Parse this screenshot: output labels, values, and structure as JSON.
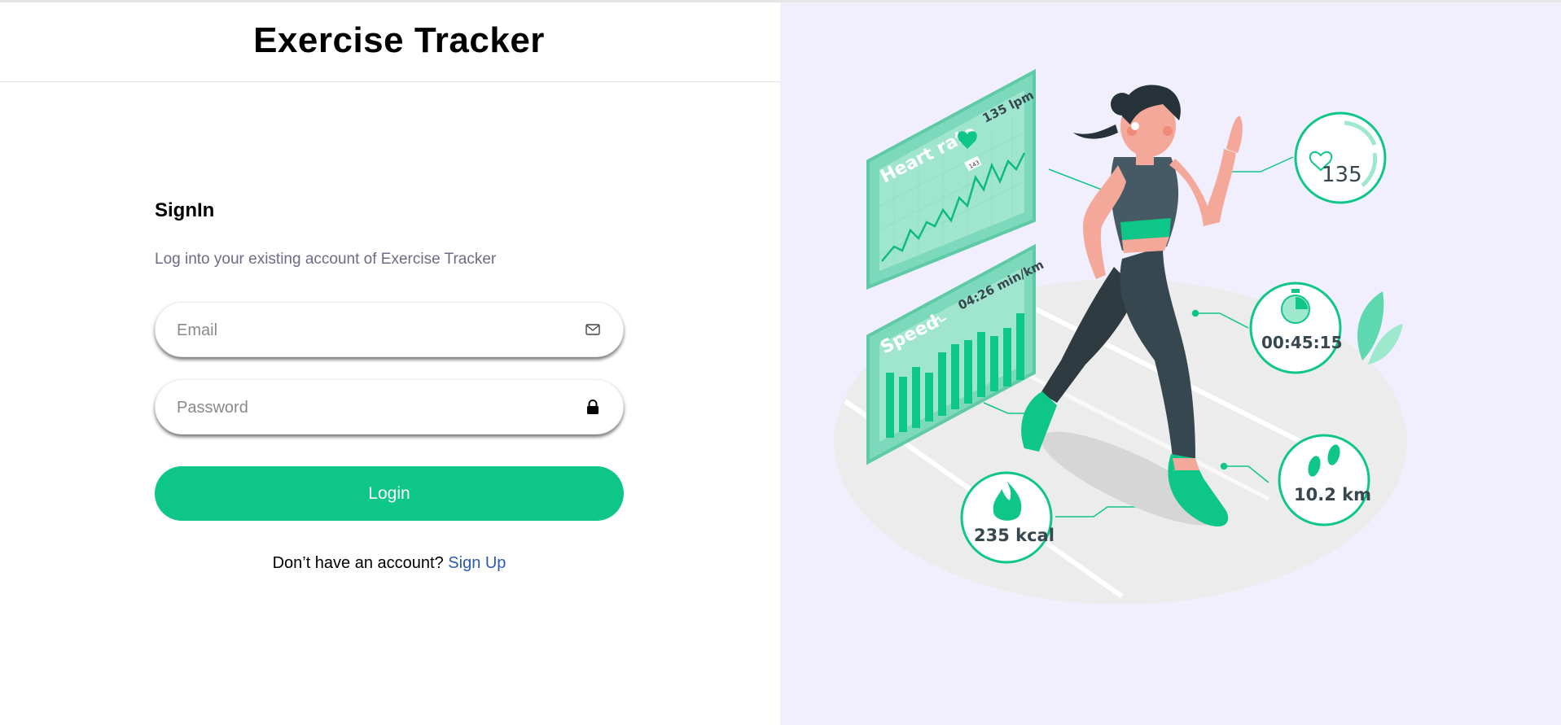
{
  "app": {
    "title": "Exercise Tracker"
  },
  "signin": {
    "title": "SignIn",
    "subtitle": "Log into your existing account of Exercise Tracker",
    "email": {
      "placeholder": "Email",
      "value": "",
      "icon": "mail-icon"
    },
    "password": {
      "placeholder": "Password",
      "value": "",
      "icon": "lock-icon"
    },
    "login_label": "Login",
    "signup_prompt": "Don’t have an account?",
    "signup_link": "Sign Up"
  },
  "illustration": {
    "heart_rate_label": "Heart rate",
    "heart_rate_value": "135 lpm",
    "graph_tag": "143",
    "speed_label": "Speed",
    "speed_value": "04:26 min/km",
    "bpm": "135",
    "time": "00:45:15",
    "calories": "235 kcal",
    "distance": "10.2 km"
  },
  "colors": {
    "accent": "#0fc689",
    "link": "#2d5aa8",
    "subtitle": "#6b6b87",
    "right_bg": "#f1effe"
  }
}
